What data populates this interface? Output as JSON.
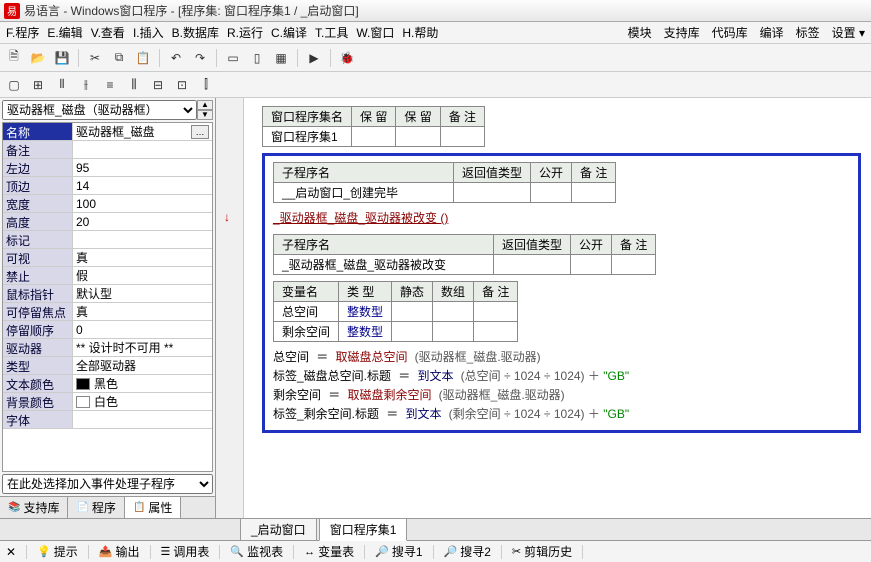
{
  "title": "易语言 - Windows窗口程序 - [程序集: 窗口程序集1 / _启动窗口]",
  "menu": {
    "items": [
      "F.程序",
      "E.编辑",
      "V.查看",
      "I.插入",
      "B.数据库",
      "R.运行",
      "C.编译",
      "T.工具",
      "W.窗口",
      "H.帮助"
    ],
    "right": [
      "模块",
      "支持库",
      "代码库",
      "编译",
      "标签",
      "设置 ▾"
    ]
  },
  "combo_selected": "驱动器框_磁盘（驱动器框）",
  "props": [
    {
      "n": "名称",
      "v": "驱动器框_磁盘",
      "sel": true,
      "more": true
    },
    {
      "n": "备注",
      "v": ""
    },
    {
      "n": "左边",
      "v": "95"
    },
    {
      "n": "顶边",
      "v": "14"
    },
    {
      "n": "宽度",
      "v": "100"
    },
    {
      "n": "高度",
      "v": "20"
    },
    {
      "n": "标记",
      "v": ""
    },
    {
      "n": "可视",
      "v": "真"
    },
    {
      "n": "禁止",
      "v": "假"
    },
    {
      "n": "鼠标指针",
      "v": "默认型"
    },
    {
      "n": "可停留焦点",
      "v": "真"
    },
    {
      "n": "  停留顺序",
      "v": "0"
    },
    {
      "n": "驱动器",
      "v": "** 设计时不可用 **"
    },
    {
      "n": "类型",
      "v": "全部驱动器"
    },
    {
      "n": "文本颜色",
      "v": "黑色",
      "color": "#000000"
    },
    {
      "n": "背景颜色",
      "v": "白色",
      "color": "#ffffff"
    },
    {
      "n": "字体",
      "v": ""
    }
  ],
  "event_combo": "在此处选择加入事件处理子程序",
  "left_tabs": [
    {
      "ico": "📚",
      "label": "支持库"
    },
    {
      "ico": "📄",
      "label": "程序"
    },
    {
      "ico": "📋",
      "label": "属性",
      "active": true
    }
  ],
  "top_table": {
    "headers": [
      "窗口程序集名",
      "保 留",
      "保 留",
      "备 注"
    ],
    "row": [
      "窗口程序集1",
      "",
      "",
      ""
    ]
  },
  "sub1": {
    "headers": [
      "子程序名",
      "返回值类型",
      "公开",
      "备 注"
    ],
    "row": "__启动窗口_创建完毕",
    "call": "_驱动器框_磁盘_驱动器被改变 ()"
  },
  "sub2": {
    "headers": [
      "子程序名",
      "返回值类型",
      "公开",
      "备 注"
    ],
    "row": "_驱动器框_磁盘_驱动器被改变"
  },
  "vars": {
    "headers": [
      "变量名",
      "类 型",
      "静态",
      "数组",
      "备 注"
    ],
    "rows": [
      [
        "总空间",
        "整数型",
        "",
        "",
        ""
      ],
      [
        "剩余空间",
        "整数型",
        "",
        "",
        ""
      ]
    ]
  },
  "code": {
    "l1": {
      "lhs": "总空间",
      "fn": "取磁盘总空间",
      "arg": "(驱动器框_磁盘.驱动器)"
    },
    "l2": {
      "lhs": "标签_磁盘总空间.标题",
      "fn": "到文本",
      "arg_pre": "(总空间 ÷ 1024 ÷ 1024) ＋ ",
      "str": "\"GB\""
    },
    "l3": {
      "lhs": "剩余空间",
      "fn": "取磁盘剩余空间",
      "arg": "(驱动器框_磁盘.驱动器)"
    },
    "l4": {
      "lhs": "标签_剩余空间.标题",
      "fn": "到文本",
      "arg_pre": "(剩余空间 ÷ 1024 ÷ 1024) ＋ ",
      "str": "\"GB\""
    }
  },
  "bottom_tabs": [
    {
      "label": "_启动窗口"
    },
    {
      "label": "窗口程序集1",
      "active": true
    }
  ],
  "status": [
    {
      "ico": "💡",
      "label": "提示"
    },
    {
      "ico": "📤",
      "label": "输出"
    },
    {
      "ico": "☰",
      "label": "调用表"
    },
    {
      "ico": "🔍",
      "label": "监视表"
    },
    {
      "ico": "↔",
      "label": "变量表"
    },
    {
      "ico": "🔎",
      "label": "搜寻1"
    },
    {
      "ico": "🔎",
      "label": "搜寻2"
    },
    {
      "ico": "✂",
      "label": "剪辑历史"
    }
  ]
}
